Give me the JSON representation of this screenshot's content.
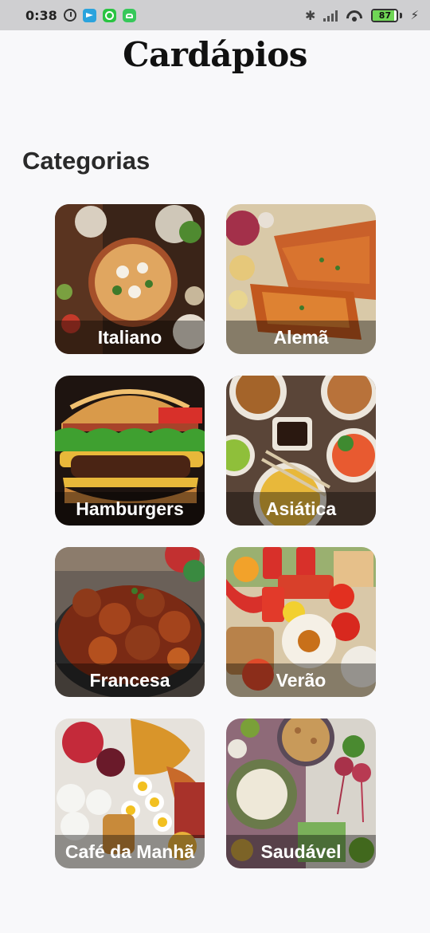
{
  "status_bar": {
    "time": "0:38",
    "battery_level": "87",
    "icons": [
      "alarm-icon",
      "telegram-icon",
      "whatsapp-icon",
      "android-icon",
      "bluetooth-icon",
      "signal-icon",
      "wifi-icon",
      "battery-icon",
      "charging-icon"
    ]
  },
  "header": {
    "title": "Cardápios"
  },
  "section": {
    "title": "Categorias"
  },
  "categories": [
    {
      "label": "Italiano",
      "image": "italian-food-image",
      "color": "#8a4a2c"
    },
    {
      "label": "Alemã",
      "image": "german-food-image",
      "color": "#c8642a"
    },
    {
      "label": "Hamburgers",
      "image": "hamburger-image",
      "color": "#7a3a1a"
    },
    {
      "label": "Asiática",
      "image": "asian-food-image",
      "color": "#6a5040"
    },
    {
      "label": "Francesa",
      "image": "french-food-image",
      "color": "#6a2a14"
    },
    {
      "label": "Verão",
      "image": "summer-food-image",
      "color": "#d84a3a"
    },
    {
      "label": "Café da Manhã",
      "image": "breakfast-image",
      "color": "#c43a3a"
    },
    {
      "label": "Saudável",
      "image": "healthy-food-image",
      "color": "#7a5a6a"
    }
  ]
}
